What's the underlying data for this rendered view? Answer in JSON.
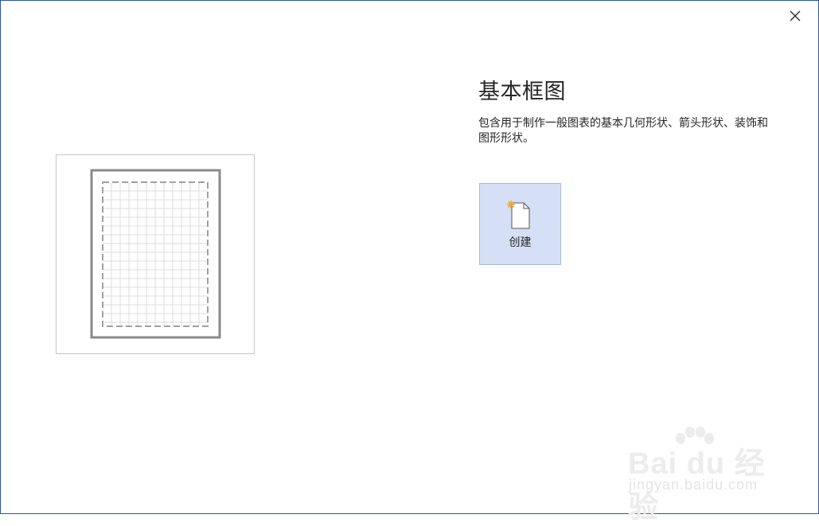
{
  "dialog": {
    "close_icon": "close-icon",
    "template": {
      "title": "基本框图",
      "description": "包含用于制作一般图表的基本几何形状、箭头形状、装饰和图形形状。",
      "preview": "page-grid-preview"
    },
    "create_button": {
      "label": "创建",
      "icon": "new-document-icon"
    }
  },
  "watermark": {
    "brand": "Bai du 经验",
    "url": "jingyan.baidu.com"
  },
  "colors": {
    "border": "#2b579a",
    "tile_bg": "#d5dff5",
    "tile_border": "#a5b9e3",
    "text": "#262626"
  }
}
